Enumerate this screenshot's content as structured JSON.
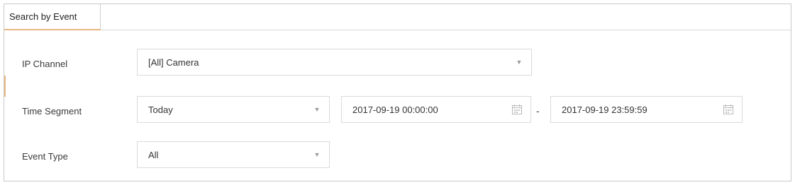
{
  "tab": {
    "label": "Search by Event"
  },
  "ip_channel": {
    "label": "IP Channel",
    "value": "[All] Camera"
  },
  "time_segment": {
    "label": "Time Segment",
    "value": "Today",
    "start": "2017-09-19 00:00:00",
    "separator": "-",
    "end": "2017-09-19 23:59:59"
  },
  "event_type": {
    "label": "Event Type",
    "value": "All"
  },
  "icons": {
    "dropdown": "chevron-down-icon",
    "calendar": "calendar-icon"
  },
  "colors": {
    "accent": "#e8b784",
    "border": "#dadada"
  }
}
